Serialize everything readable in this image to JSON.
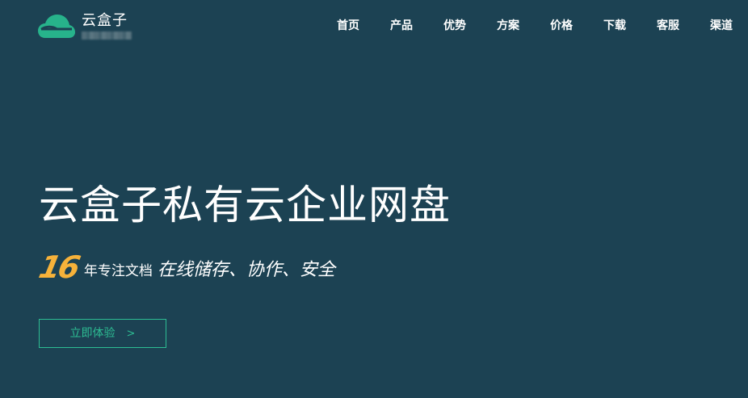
{
  "brand": {
    "name": "云盒子",
    "logo_icon": "cloud-icon",
    "accent_color": "#2dbd93"
  },
  "nav": {
    "items": [
      {
        "label": "首页"
      },
      {
        "label": "产品"
      },
      {
        "label": "优势"
      },
      {
        "label": "方案"
      },
      {
        "label": "价格"
      },
      {
        "label": "下载"
      },
      {
        "label": "客服"
      },
      {
        "label": "渠道"
      }
    ]
  },
  "hero": {
    "title": "云盒子私有云企业网盘",
    "tagline_number": "16",
    "tagline_middle": "年专注文档",
    "tagline_end": "在线储存、协作、安全",
    "number_color": "#f6b23a",
    "cta_label": "立即体验",
    "cta_icon": "chevron-right-icon",
    "background_color": "#1c4253"
  }
}
